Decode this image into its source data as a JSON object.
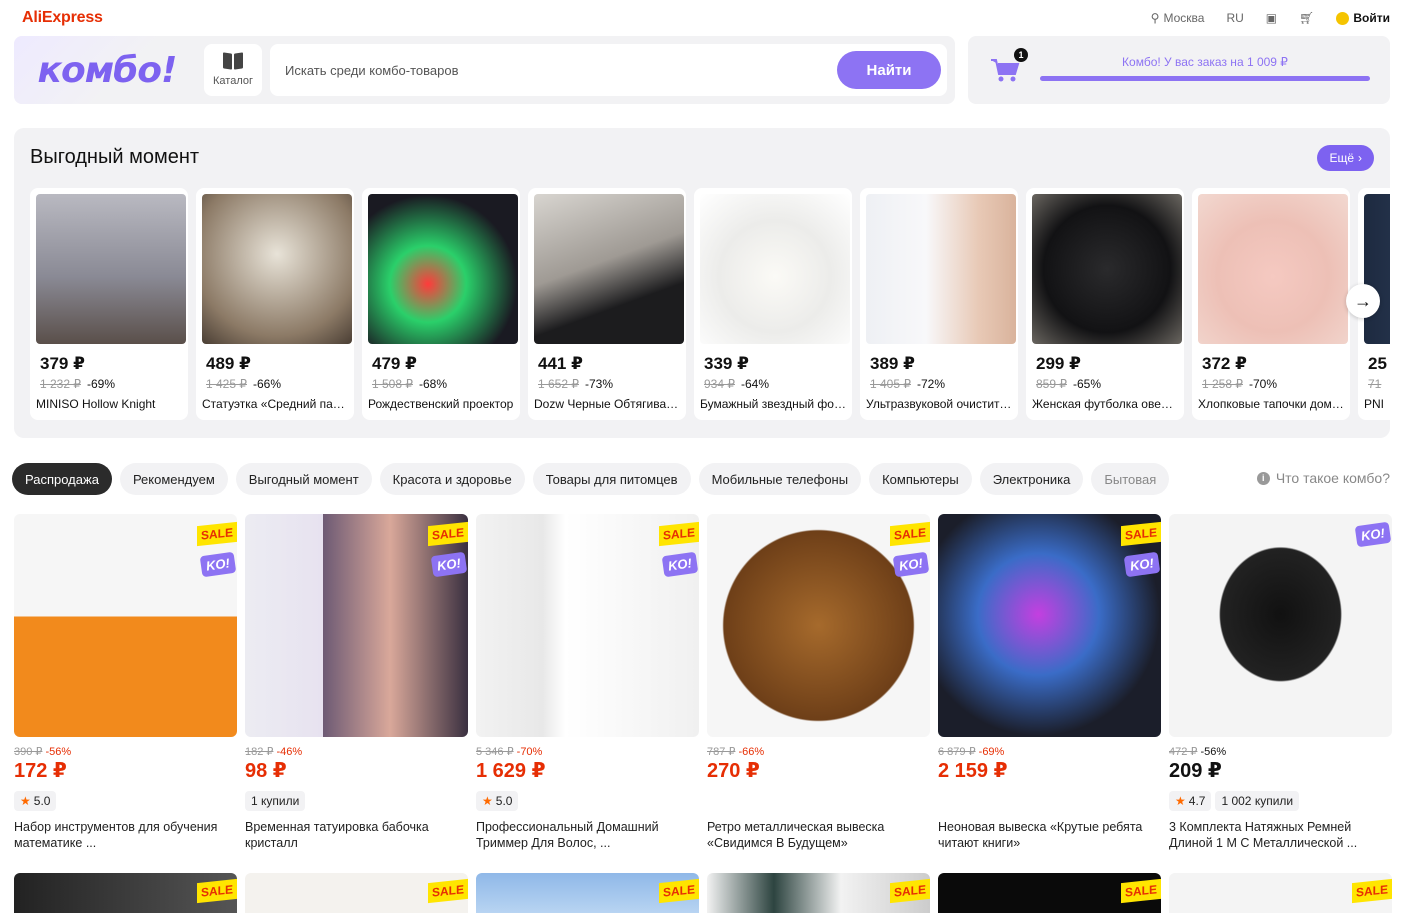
{
  "header": {
    "logo": "AliExpress",
    "city": "Москва",
    "lang": "RU",
    "login": "Войти"
  },
  "combo": {
    "logo_text": "комбо!",
    "catalog_label": "Каталог",
    "search_placeholder": "Искать среди комбо-товаров",
    "search_button": "Найти",
    "cart_count": "1",
    "cart_message": "Комбо! У вас заказ на 1 009 ₽",
    "cart_progress": 1.0
  },
  "moment": {
    "title": "Выгодный момент",
    "more_label": "Ещё",
    "cards": [
      {
        "price": "379 ₽",
        "old": "1 232 ₽",
        "discount": "-69%",
        "name": "MINISO Hollow Knight"
      },
      {
        "price": "489 ₽",
        "old": "1 425 ₽",
        "discount": "-66%",
        "name": "Статуэтка «Средний палец»"
      },
      {
        "price": "479 ₽",
        "old": "1 508 ₽",
        "discount": "-68%",
        "name": "Рождественский проектор"
      },
      {
        "price": "441 ₽",
        "old": "1 652 ₽",
        "discount": "-73%",
        "name": "Dozw Черные Обтягивающие"
      },
      {
        "price": "339 ₽",
        "old": "934 ₽",
        "discount": "-64%",
        "name": "Бумажный звездный фонарь"
      },
      {
        "price": "389 ₽",
        "old": "1 405 ₽",
        "discount": "-72%",
        "name": "Ультразвуковой очиститель"
      },
      {
        "price": "299 ₽",
        "old": "859 ₽",
        "discount": "-65%",
        "name": "Женская футболка оверсайз"
      },
      {
        "price": "372 ₽",
        "old": "1 258 ₽",
        "discount": "-70%",
        "name": "Хлопковые тапочки домашние"
      },
      {
        "price": "25",
        "old": "71",
        "discount": "",
        "name": "PNI"
      }
    ]
  },
  "tabs": [
    "Распродажа",
    "Рекомендуем",
    "Выгодный момент",
    "Красота и здоровье",
    "Товары для питомцев",
    "Мобильные телефоны",
    "Компьютеры",
    "Электроника",
    "Бытовая"
  ],
  "whatis_label": "Что такое комбо?",
  "products": [
    {
      "old": "390 ₽",
      "discount": "-56%",
      "price": "172 ₽",
      "rating": "5.0",
      "bought": "",
      "name": "Набор инструментов для обучения математике  ...",
      "sale": true
    },
    {
      "old": "182 ₽",
      "discount": "-46%",
      "price": "98 ₽",
      "rating": "",
      "bought": "1 купили",
      "name": "Временная татуировка бабочка кристалл",
      "sale": true
    },
    {
      "old": "5 346 ₽",
      "discount": "-70%",
      "price": "1 629 ₽",
      "rating": "5.0",
      "bought": "",
      "name": "Профессиональный Домашний Триммер Для Волос, ...",
      "sale": true
    },
    {
      "old": "787 ₽",
      "discount": "-66%",
      "price": "270 ₽",
      "rating": "",
      "bought": "",
      "name": "Ретро металлическая вывеска «Свидимся В Будущем»",
      "sale": true
    },
    {
      "old": "6 879 ₽",
      "discount": "-69%",
      "price": "2 159 ₽",
      "rating": "",
      "bought": "",
      "name": "Неоновая вывеска «Крутые ребята читают книги»",
      "sale": true
    },
    {
      "old": "472 ₽",
      "discount": "-56%",
      "price": "209 ₽",
      "rating": "4.7",
      "bought": "1 002 купили",
      "name": "3 Комплекта Натяжных Ремней Длиной 1 М С Металлической ...",
      "sale": false
    }
  ],
  "row2_labels": {
    "sale": "SALE",
    "ko": "KO!"
  },
  "colors": {
    "brand": "#e62e04",
    "accent": "#8d73f3",
    "sale_yellow": "#ffe500"
  }
}
